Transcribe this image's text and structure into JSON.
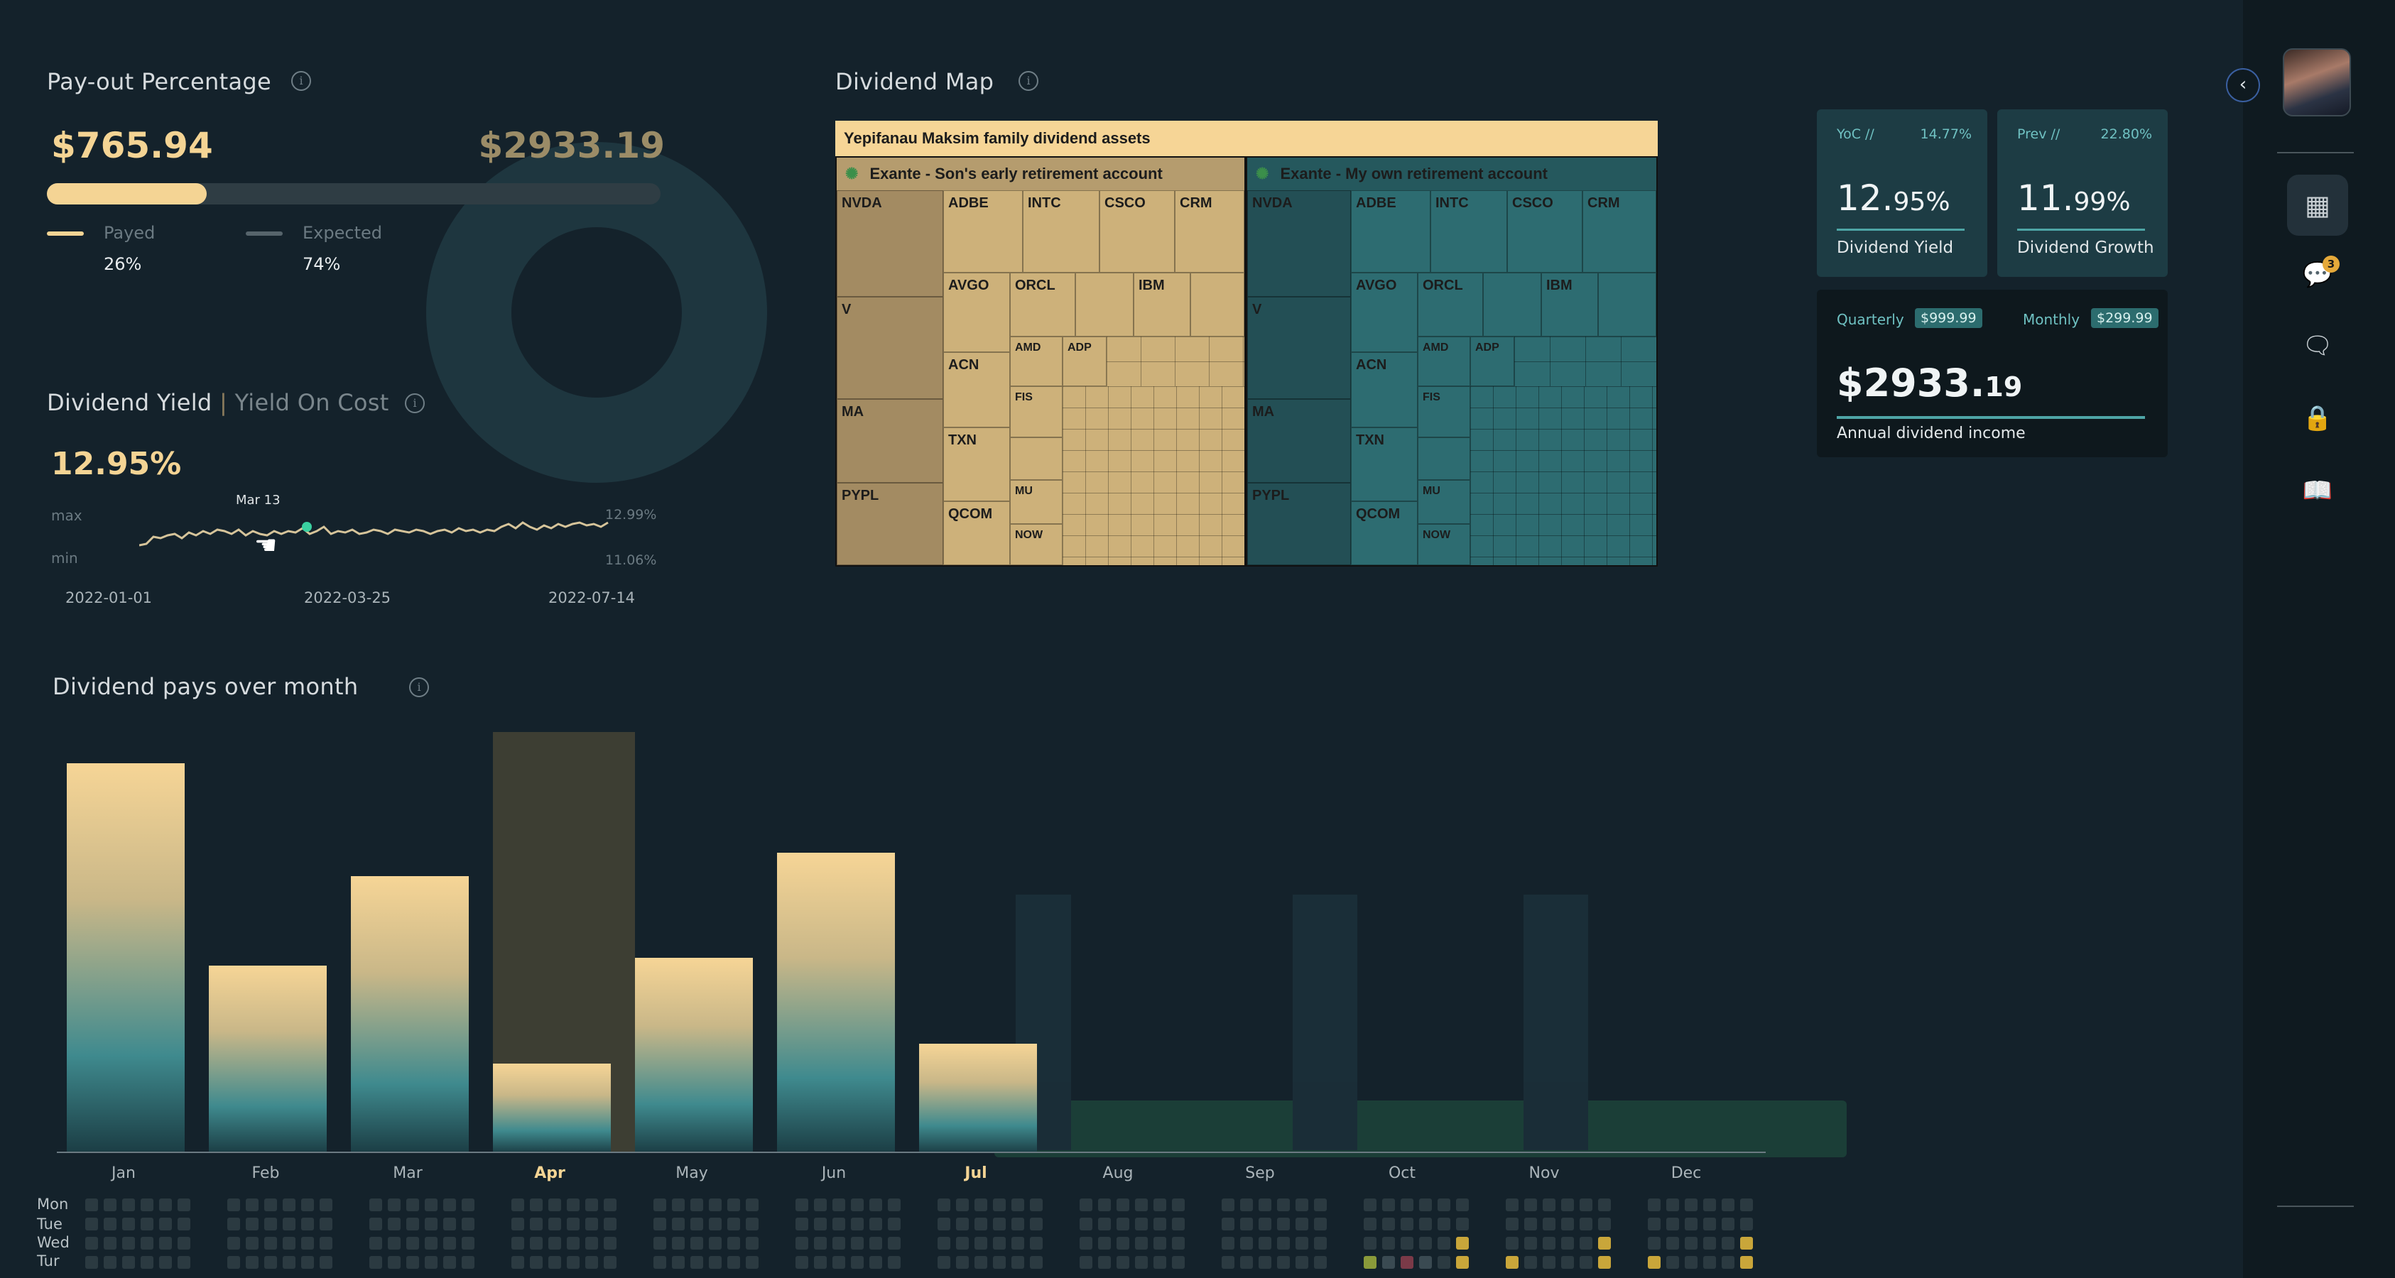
{
  "payout": {
    "title": "Pay-out Percentage",
    "paid_amount": "$765.94",
    "expected_amount": "$2933.19",
    "progress_fraction": 0.26,
    "legend": [
      {
        "label": "Payed",
        "value": "26%"
      },
      {
        "label": "Expected",
        "value": "74%"
      }
    ]
  },
  "yield": {
    "title": "Dividend Yield",
    "separator": "|",
    "title_alt": "Yield On Cost",
    "value": "12.95%",
    "tooltip_label": "Mar 13",
    "max_label": "max",
    "min_label": "min",
    "max_value": "12.99%",
    "min_value": "11.06%",
    "dates": [
      "2022-01-01",
      "2022-03-25",
      "2022-07-14"
    ]
  },
  "map": {
    "title": "Dividend Map",
    "root_label": "Yepifanau Maksim family dividend assets",
    "accounts": [
      {
        "label": "Exante - Son's early retirement account",
        "color": "#cdb17a",
        "dark": "#a38b62"
      },
      {
        "label": "Exante - My own retirement account",
        "color": "#2d6c71",
        "dark": "#234f55"
      }
    ],
    "tickers": [
      "NVDA",
      "ADBE",
      "INTC",
      "CSCO",
      "CRM",
      "V",
      "AVGO",
      "ORCL",
      "IBM",
      "ACN",
      "AMD",
      "ADP",
      "FIS",
      "MA",
      "TXN",
      "MU",
      "PYPL",
      "QCOM",
      "NOW"
    ]
  },
  "stats": {
    "yoc_label": "YoC //",
    "yoc_value": "14.77%",
    "prev_label": "Prev //",
    "prev_value": "22.80%",
    "dividend_yield": {
      "main": "12.",
      "decimals": "95%",
      "label": "Dividend Yield"
    },
    "dividend_growth": {
      "main": "11.",
      "decimals": "99%",
      "label": "Dividend Growth"
    },
    "quarterly_label": "Quarterly",
    "quarterly_value": "$999.99",
    "monthly_label": "Monthly",
    "monthly_value": "$299.99",
    "annual_main": "$2933.",
    "annual_decimals": "19",
    "annual_label": "Annual dividend income"
  },
  "monthly": {
    "title": "Dividend pays over month",
    "months": [
      "Jan",
      "Feb",
      "Mar",
      "Apr",
      "May",
      "Jun",
      "Jul",
      "Aug",
      "Sep",
      "Oct",
      "Nov",
      "Dec"
    ],
    "active_months": [
      "Apr",
      "Jul"
    ],
    "days": [
      "Mon",
      "Tue",
      "Wed",
      "Tur"
    ]
  },
  "chart_data": {
    "type": "bar",
    "categories": [
      "Jan",
      "Feb",
      "Mar",
      "Apr",
      "May",
      "Jun",
      "Jul",
      "Aug",
      "Sep",
      "Oct",
      "Nov",
      "Dec"
    ],
    "values": [
      100,
      48,
      71,
      23,
      50,
      77,
      28,
      0,
      0,
      0,
      0,
      0
    ],
    "highlight": {
      "Apr": 108
    },
    "ylim": [
      0,
      110
    ],
    "title": "Dividend pays over month"
  },
  "sidebar": {
    "notification_count": "3",
    "collapse_icon": "chevron-left-icon",
    "items": [
      "dashboard-icon",
      "chat-icon",
      "comments-icon",
      "lock-icon",
      "book-icon"
    ]
  }
}
